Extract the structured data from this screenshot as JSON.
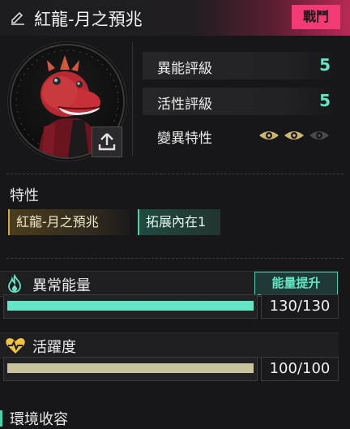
{
  "header": {
    "title": "紅龍-月之預兆",
    "badge": "戰鬥"
  },
  "stats": [
    {
      "label": "異能評級",
      "value": "5"
    },
    {
      "label": "活性評級",
      "value": "5"
    },
    {
      "label": "變異特性"
    }
  ],
  "mutation_traits": {
    "total": 3,
    "active": 2
  },
  "traits": {
    "title": "特性",
    "tags": [
      "紅龍-月之預兆",
      "拓展內在1"
    ]
  },
  "energy": {
    "name": "異常能量",
    "boost_label": "能量提升",
    "current": 130,
    "max": 130,
    "value_text": "130/130",
    "color": "#63e6c6"
  },
  "activity": {
    "name": "活躍度",
    "current": 100,
    "max": 100,
    "value_text": "100/100",
    "color": "#c9c4a0"
  },
  "footer": {
    "section_title": "環境收容"
  },
  "colors": {
    "accent_teal": "#63e6c6",
    "accent_pink": "#f23a74",
    "accent_gold": "#c9a94b"
  }
}
